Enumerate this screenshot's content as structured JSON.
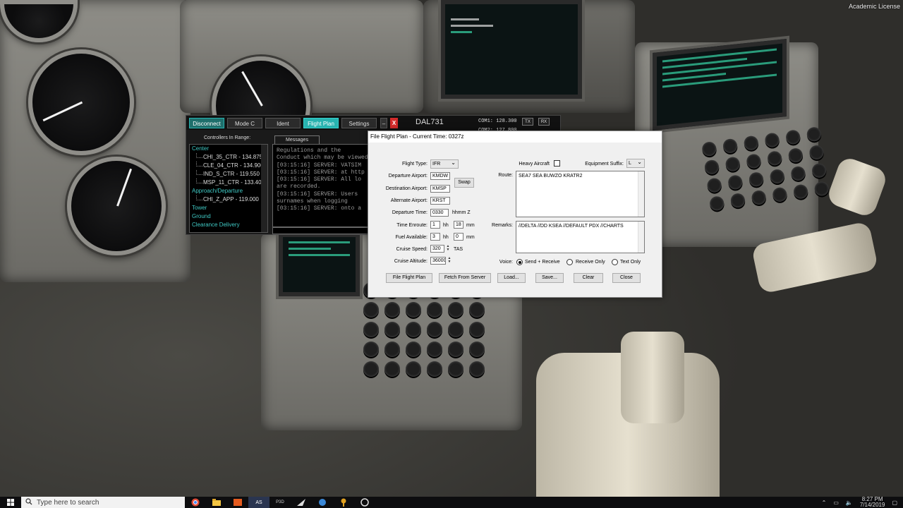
{
  "watermark": "Academic License",
  "client": {
    "buttons": {
      "disconnect": "Disconnect",
      "mode_c": "Mode C",
      "ident": "Ident",
      "flight_plan": "Flight Plan",
      "settings": "Settings",
      "minimize": "–",
      "close": "X"
    },
    "callsign": "DAL731",
    "com1": "COM1: 128.300",
    "com2": "COM2: 127.800",
    "tx": "TX",
    "rx": "RX",
    "controllers_title": "Controllers In Range:",
    "controllers": [
      {
        "type": "cat",
        "text": "Center"
      },
      {
        "type": "it",
        "text": "CHI_35_CTR - 134.875"
      },
      {
        "type": "it",
        "text": "CLE_04_CTR - 134.900"
      },
      {
        "type": "it",
        "text": "IND_S_CTR - 119.550"
      },
      {
        "type": "it",
        "text": "MSP_11_CTR - 133.400"
      },
      {
        "type": "cat",
        "text": "Approach/Departure"
      },
      {
        "type": "it",
        "text": "CHI_Z_APP - 119.000"
      },
      {
        "type": "cat",
        "text": "Tower"
      },
      {
        "type": "cat",
        "text": "Ground"
      },
      {
        "type": "cat",
        "text": "Clearance Delivery"
      }
    ],
    "messages_tab": "Messages",
    "messages": [
      "Regulations and the",
      "Conduct which may be viewed",
      "[03:15:16] SERVER: VATSIM",
      "[03:15:16] SERVER: at http",
      "[03:15:16] SERVER: All lo",
      "are recorded.",
      "[03:15:16] SERVER: Users",
      "surnames when logging",
      "[03:15:16] SERVER: onto a"
    ]
  },
  "flight_plan": {
    "title": "File Flight Plan - Current Time: 0327z",
    "labels": {
      "flight_type": "Flight Type:",
      "departure": "Departure Airport:",
      "destination": "Destination Airport:",
      "alternate": "Alternate Airport:",
      "departure_time": "Departure Time:",
      "time_enroute": "Time Enroute:",
      "fuel_available": "Fuel Available:",
      "cruise_speed": "Cruise Speed:",
      "cruise_altitude": "Cruise Altitude:",
      "heavy": "Heavy Aircraft",
      "equipment_suffix": "Equipment Suffix:",
      "route": "Route:",
      "remarks": "Remarks:",
      "voice": "Voice:"
    },
    "values": {
      "flight_type": "IFR",
      "departure": "KMDW",
      "destination": "KMSP",
      "alternate": "KRST",
      "departure_time": "0330",
      "enroute_hh": "1",
      "enroute_mm": "18",
      "fuel_hh": "3",
      "fuel_mm": "0",
      "cruise_speed": "320",
      "cruise_altitude": "36000",
      "equipment_suffix": "L",
      "route": "SEA7 SEA BUWZO KRATR2",
      "remarks": "//DELTA //DD KSEA //DEFAULT PDX //CHARTS",
      "heavy_checked": false,
      "voice_selected": "Send + Receive"
    },
    "units": {
      "hhmm_z": "hhmm Z",
      "hh": "hh",
      "mm": "mm",
      "tas": "TAS"
    },
    "swap": "Swap",
    "voice_options": [
      "Send + Receive",
      "Receive Only",
      "Text Only"
    ],
    "buttons": {
      "file": "File Flight Plan",
      "fetch": "Fetch From Server",
      "load": "Load...",
      "save": "Save...",
      "clear": "Clear",
      "close": "Close"
    }
  },
  "taskbar": {
    "search_placeholder": "Type here to search",
    "time": "8:27 PM",
    "date": "7/14/2019"
  }
}
